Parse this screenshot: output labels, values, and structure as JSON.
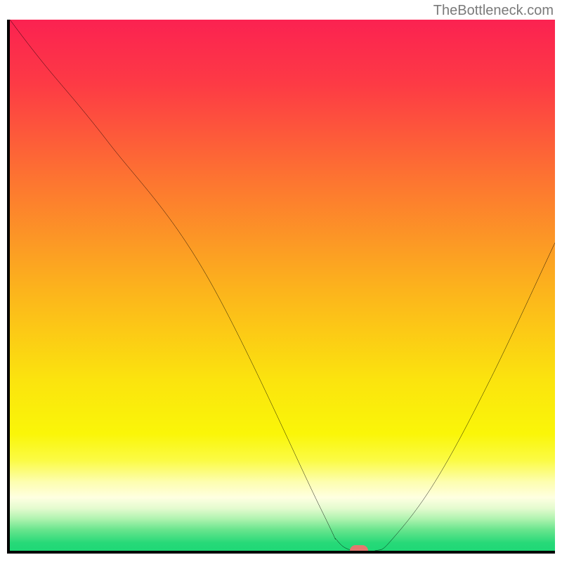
{
  "attribution": "TheBottleneck.com",
  "chart_data": {
    "type": "line",
    "title": "",
    "xlabel": "",
    "ylabel": "",
    "xlim": [
      0,
      100
    ],
    "ylim": [
      0,
      100
    ],
    "x": [
      0,
      6,
      18,
      36,
      57,
      60,
      63,
      67,
      70,
      78,
      88,
      100
    ],
    "values": [
      100,
      92,
      77,
      52,
      8,
      2,
      0,
      0,
      2,
      13,
      32,
      58
    ],
    "marker": {
      "x": 64,
      "y": 0
    },
    "gradient_stops": [
      {
        "pct": 0,
        "color": "#fb2251"
      },
      {
        "pct": 12,
        "color": "#fd3a45"
      },
      {
        "pct": 30,
        "color": "#fd7431"
      },
      {
        "pct": 50,
        "color": "#fcb11d"
      },
      {
        "pct": 68,
        "color": "#fbe40e"
      },
      {
        "pct": 78,
        "color": "#faf608"
      },
      {
        "pct": 83,
        "color": "#fbfb45"
      },
      {
        "pct": 87,
        "color": "#fdfeaf"
      },
      {
        "pct": 90,
        "color": "#feffe1"
      },
      {
        "pct": 92,
        "color": "#e4fbcf"
      },
      {
        "pct": 94,
        "color": "#aff3af"
      },
      {
        "pct": 96,
        "color": "#6ae58e"
      },
      {
        "pct": 98.5,
        "color": "#27d978"
      },
      {
        "pct": 100,
        "color": "#1fd876"
      }
    ]
  }
}
